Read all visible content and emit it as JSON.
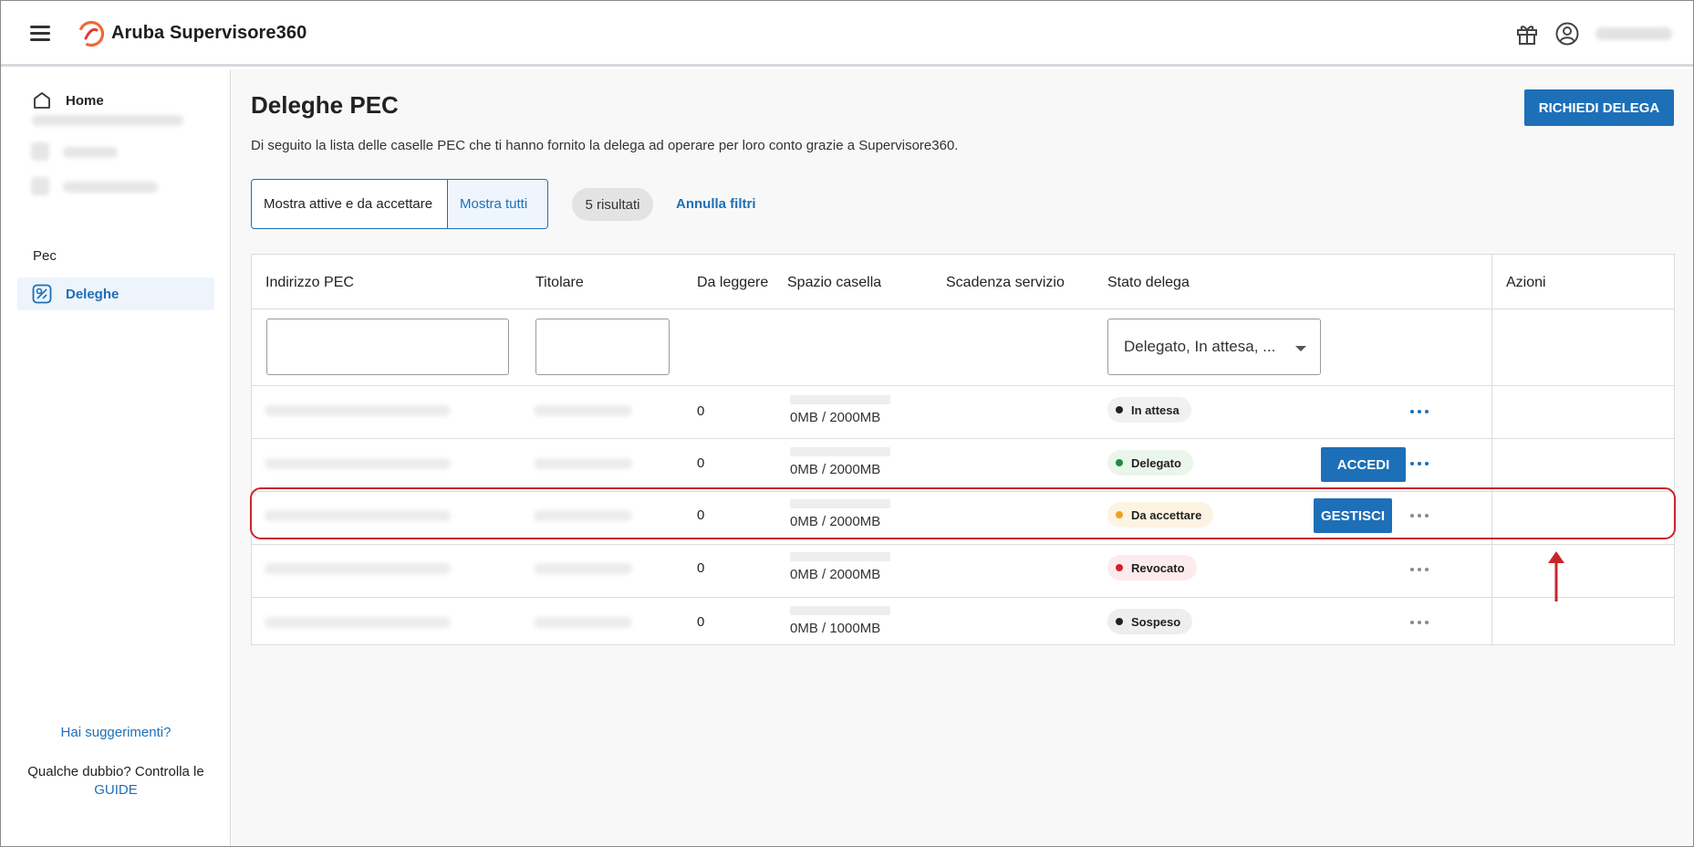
{
  "header": {
    "brand": "Aruba Supervisore360",
    "colors": {
      "accent": "#1d6fb8",
      "logo_orange": "#ee6a33",
      "logo_red": "#e53935"
    }
  },
  "sidebar": {
    "home_label": "Home",
    "section_label": "Pec",
    "deleghe_label": "Deleghe",
    "help_link": "Hai suggerimenti?",
    "help_text_prefix": "Qualche dubbio? Controlla le",
    "help_text_link": "GUIDE"
  },
  "main": {
    "title": "Deleghe PEC",
    "description": "Di seguito la lista delle caselle PEC che ti hanno fornito la delega ad operare per loro conto grazie a Supervisore360.",
    "request_button": "RICHIEDI DELEGA",
    "toggle_active": "Mostra attive e da accettare",
    "toggle_all": "Mostra tutti",
    "results_chip": "5 risultati",
    "clear_filters": "Annulla filtri"
  },
  "table": {
    "headers": [
      "Indirizzo PEC",
      "Titolare",
      "Da leggere",
      "Spazio casella",
      "Scadenza servizio",
      "Stato delega",
      "Azioni"
    ],
    "status_filter_value": "Delegato, In attesa, ...",
    "rows": [
      {
        "unread": "0",
        "quota": "0MB / 2000MB",
        "status": "In attesa",
        "status_dot": "#222222",
        "status_bg": "#f1f1f1",
        "action": "",
        "more_color": "#1d6fb8"
      },
      {
        "unread": "0",
        "quota": "0MB / 2000MB",
        "status": "Delegato",
        "status_dot": "#1e8e3e",
        "status_bg": "#eaf6ec",
        "action": "ACCEDI",
        "more_color": "#1d6fb8"
      },
      {
        "unread": "0",
        "quota": "0MB / 2000MB",
        "status": "Da accettare",
        "status_dot": "#f0a020",
        "status_bg": "#fdf3e3",
        "action": "GESTISCI",
        "more_color": "#8a8a8a"
      },
      {
        "unread": "0",
        "quota": "0MB / 2000MB",
        "status": "Revocato",
        "status_dot": "#d32030",
        "status_bg": "#fcebec",
        "action": "",
        "more_color": "#8a8a8a"
      },
      {
        "unread": "0",
        "quota": "0MB / 1000MB",
        "status": "Sospeso",
        "status_dot": "#222222",
        "status_bg": "#eeeeee",
        "action": "",
        "more_color": "#8a8a8a"
      }
    ]
  }
}
